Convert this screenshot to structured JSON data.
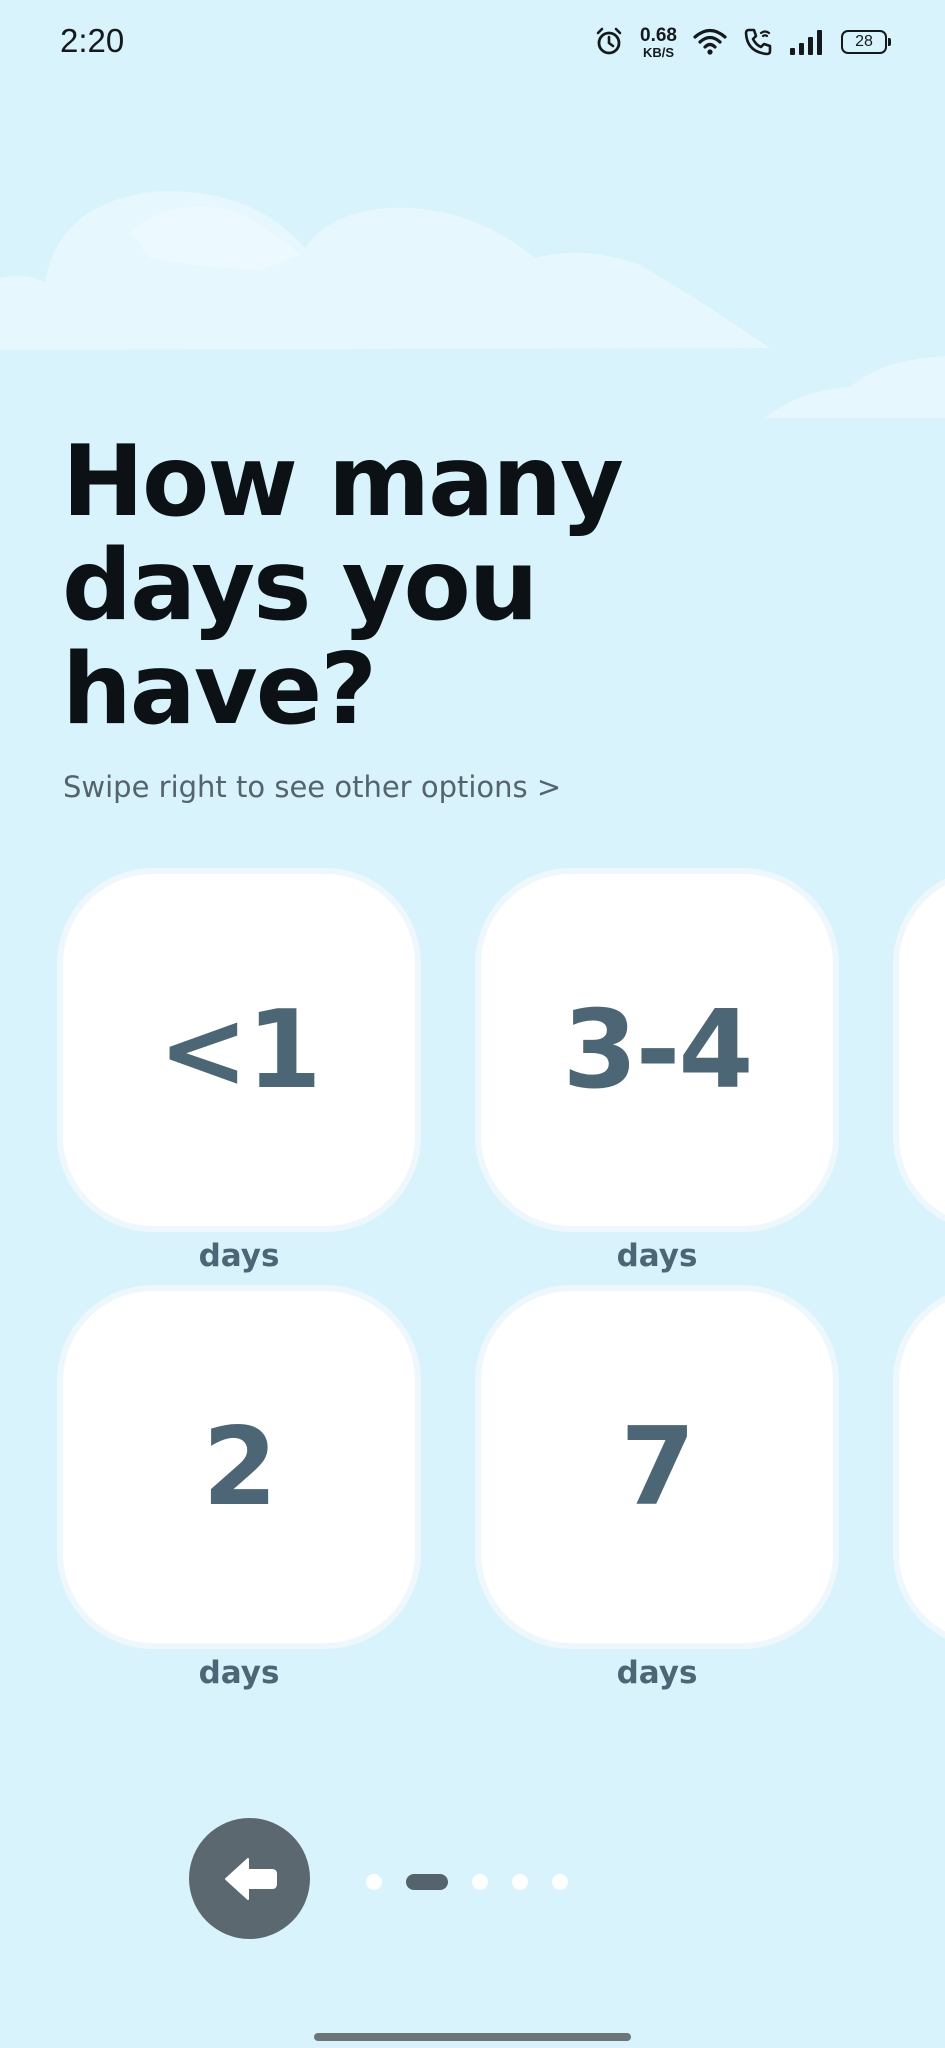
{
  "status_bar": {
    "time": "2:20",
    "net_speed_value": "0.68",
    "net_speed_unit": "KB/S",
    "battery": "28",
    "icons": [
      "alarm-icon",
      "wifi-icon",
      "wifi-call-icon",
      "signal-icon",
      "battery-icon"
    ]
  },
  "question": {
    "title_lines": [
      "How many",
      "days you",
      "have?"
    ],
    "subtitle": "Swipe right to see other options >"
  },
  "options": [
    {
      "value": "<1",
      "unit": "days"
    },
    {
      "value": "3-4",
      "unit": "days"
    },
    {
      "value": "2",
      "unit": "days"
    },
    {
      "value": "7",
      "unit": "days"
    }
  ],
  "navigation": {
    "back_icon": "arrow-left-icon",
    "page_count": 5,
    "active_page": 2
  },
  "colors": {
    "background": "#d8f3fc",
    "card": "#ffffff",
    "card_text": "#4d6676",
    "back_button": "#5b686f"
  }
}
